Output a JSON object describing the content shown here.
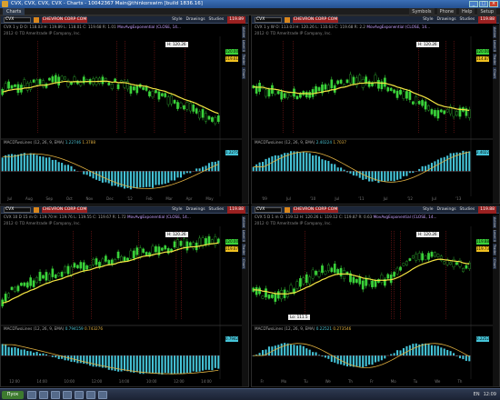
{
  "window": {
    "title": "CVX, CVX, CVX, CVX - Charts - 10042367 Main@thinkorswim [build 1836.16]",
    "buttons": [
      "_",
      "□",
      "×"
    ]
  },
  "appbar": {
    "tab": "Charts",
    "right_items": [
      "Symbols",
      "Phone",
      "Help",
      "Setup"
    ]
  },
  "panes": [
    {
      "symbol": "CVX",
      "news": "CHEVRON CORP COM",
      "toolbar": [
        "Style",
        "Drawings",
        "Studies"
      ],
      "price": "119.89",
      "header": "CVX 1 y D  O: 118.03  H: 119.89  L: 118.01  C: 119.68  R: 1.01",
      "study": "MovAvgExponential (CLOSE, 14...",
      "copyright": "2012 © TD Ameritrade IP Company, Inc.",
      "high_label": "H: 120.26",
      "tag_green": "120.00",
      "tag_yellow": "119.61",
      "macd_label": "MACDTwoLines (12, 26, 9, EMA)",
      "macd_v1": "1.22746",
      "macd_v2": "1.3788",
      "macd_tag": "1.2275",
      "x_labels": [
        "Jul",
        "Aug",
        "Sep",
        "Oct",
        "Nov",
        "Dec",
        "'12",
        "Feb",
        "Mar",
        "Apr",
        "May"
      ]
    },
    {
      "symbol": "CVX",
      "news": "CHEVRON CORP COM",
      "toolbar": [
        "Style",
        "Drawings",
        "Studies"
      ],
      "price": "119.88",
      "header": "CVX 1 y W  O: 113.03  H: 120.26  L: 110.63  C: 119.68  R: 2.2",
      "study": "MovAvgExponential (CLOSE, 14...",
      "copyright": "2012 © TD Ameritrade IP Company, Inc.",
      "high_label": "H: 120.26",
      "tag_green": "120.00",
      "tag_yellow": "114.87",
      "macd_label": "MACDTwoLines (12, 26, 9, EMA)",
      "macd_v1": "2.40224",
      "macd_v2": "1.7037",
      "macd_tag": "2.4022",
      "x_labels": [
        "'09",
        "Jul",
        "'10",
        "Jul",
        "'11",
        "Jul",
        "'12",
        "Jul",
        "'13"
      ]
    },
    {
      "symbol": "CVX",
      "news": "CHEVRON CORP COM",
      "toolbar": [
        "Style",
        "Drawings",
        "Studies"
      ],
      "price": "119.88",
      "header": "CVX 10 D 15 m  O: 119.70  H: 119.76  L: 119.55  C: 119.67  R: 1.72",
      "study": "MovAvgExponential (CLOSE, 14...",
      "copyright": "2012 © TD Ameritrade IP Company, Inc.",
      "high_label": "H: 120.26",
      "tag_green": "120.00",
      "tag_yellow": "119.67",
      "macd_label": "MACDTwoLines (12, 26, 9, EMA)",
      "macd_v1": "0.794159",
      "macd_v2": "0.743276",
      "macd_tag": "0.7942",
      "x_labels": [
        "12:00",
        "14:00",
        "10:00",
        "12:00",
        "14:00",
        "10:00",
        "12:00",
        "14:00"
      ]
    },
    {
      "symbol": "CVX",
      "news": "CHEVRON CORP COM",
      "toolbar": [
        "Style",
        "Drawings",
        "Studies"
      ],
      "price": "119.88",
      "header": "CVX 5 D 1 m  O: 119.12  H: 120.26  L: 119.12  C: 119.87  R: 0.63",
      "study": "MovAvgExponential (CLOSE, 14...",
      "copyright": "2012 © TD Ameritrade IP Company, Inc.",
      "high_label": "H: 120.26",
      "low_label": "Lo: 111.5",
      "tag_green": "119.88",
      "tag_yellow": "119.73",
      "macd_label": "MACDTwoLines (12, 26, 9, EMA)",
      "macd_v1": "0.22521",
      "macd_v2": "0.273546",
      "macd_tag": "0.2252",
      "x_labels": [
        "Fr",
        "Mo",
        "Tu",
        "We",
        "Th",
        "Fr",
        "Mo",
        "Tu",
        "We",
        "Th"
      ]
    }
  ],
  "side_tabs": [
    "Active",
    "Level II",
    "Trader",
    "Chart"
  ],
  "taskbar": {
    "start": "Пуск",
    "lang": "EN",
    "clock": "12:09"
  },
  "colors": {
    "candle_up": "#3ad33a",
    "ema": "#f5e642",
    "macd_hist": "#45c4d8",
    "signal": "#e0b040",
    "news_red": "#9a2020"
  }
}
